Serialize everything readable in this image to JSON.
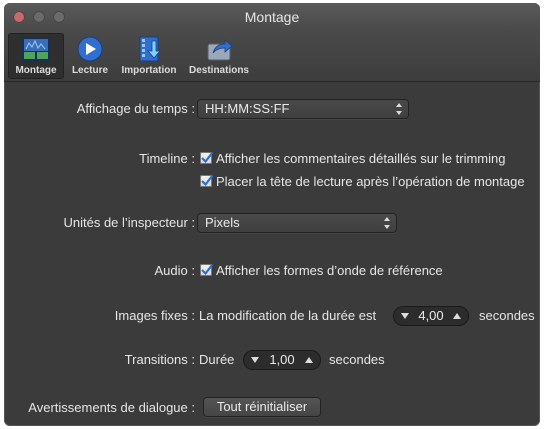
{
  "window": {
    "title": "Montage"
  },
  "toolbar": {
    "items": [
      {
        "label": "Montage",
        "icon": "montage-icon",
        "active": true
      },
      {
        "label": "Lecture",
        "icon": "play-icon",
        "active": false
      },
      {
        "label": "Importation",
        "icon": "import-icon",
        "active": false
      },
      {
        "label": "Destinations",
        "icon": "share-icon",
        "active": false
      }
    ]
  },
  "settings": {
    "time_display": {
      "label": "Affichage du temps :",
      "value": "HH:MM:SS:FF"
    },
    "timeline": {
      "label": "Timeline :",
      "option1": "Afficher les commentaires détaillés sur le trimming",
      "option1_checked": true,
      "option2": "Placer la tête de lecture après l’opération de montage",
      "option2_checked": true
    },
    "inspector_units": {
      "label": "Unités de l’inspecteur :",
      "value": "Pixels"
    },
    "audio": {
      "label": "Audio :",
      "option": "Afficher les formes d’onde de référence",
      "checked": true
    },
    "still_images": {
      "label": "Images fixes :",
      "text": "La modification de la durée est",
      "value": "4,00",
      "unit": "secondes"
    },
    "transitions": {
      "label": "Transitions :",
      "text": "Durée",
      "value": "1,00",
      "unit": "secondes"
    },
    "dialog_warnings": {
      "label": "Avertissements de dialogue :",
      "button": "Tout réinitialiser"
    }
  },
  "colors": {
    "background": "#3b3b3b",
    "accent": "#2f6fd0",
    "text": "#e6e6e6"
  }
}
